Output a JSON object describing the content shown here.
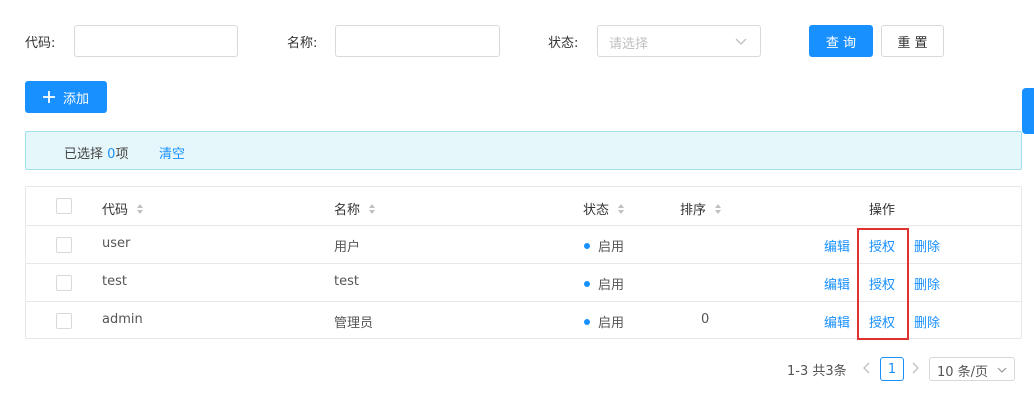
{
  "filters": {
    "code_label": "代码:",
    "name_label": "名称:",
    "status_label": "状态:",
    "status_placeholder": "请选择",
    "query_button": "查 询",
    "reset_button": "重 置"
  },
  "toolbar": {
    "add_button": "添加"
  },
  "alert": {
    "prefix": "已选择",
    "count": "0",
    "suffix": "项",
    "clear": "清空"
  },
  "table": {
    "columns": {
      "code": "代码",
      "name": "名称",
      "status": "状态",
      "sort": "排序",
      "actions": "操作"
    },
    "rows": [
      {
        "code": "user",
        "name": "用户",
        "status": "启用",
        "sort": "",
        "edit": "编辑",
        "grant": "授权",
        "delete": "删除"
      },
      {
        "code": "test",
        "name": "test",
        "status": "启用",
        "sort": "",
        "edit": "编辑",
        "grant": "授权",
        "delete": "删除"
      },
      {
        "code": "admin",
        "name": "管理员",
        "status": "启用",
        "sort": "0",
        "edit": "编辑",
        "grant": "授权",
        "delete": "删除"
      }
    ]
  },
  "pagination": {
    "total": "1-3 共3条",
    "current_page": "1",
    "page_size": "10 条/页"
  },
  "colors": {
    "primary": "#1890ff",
    "highlight": "#e0312f",
    "alert_bg": "#e6f7fb"
  }
}
